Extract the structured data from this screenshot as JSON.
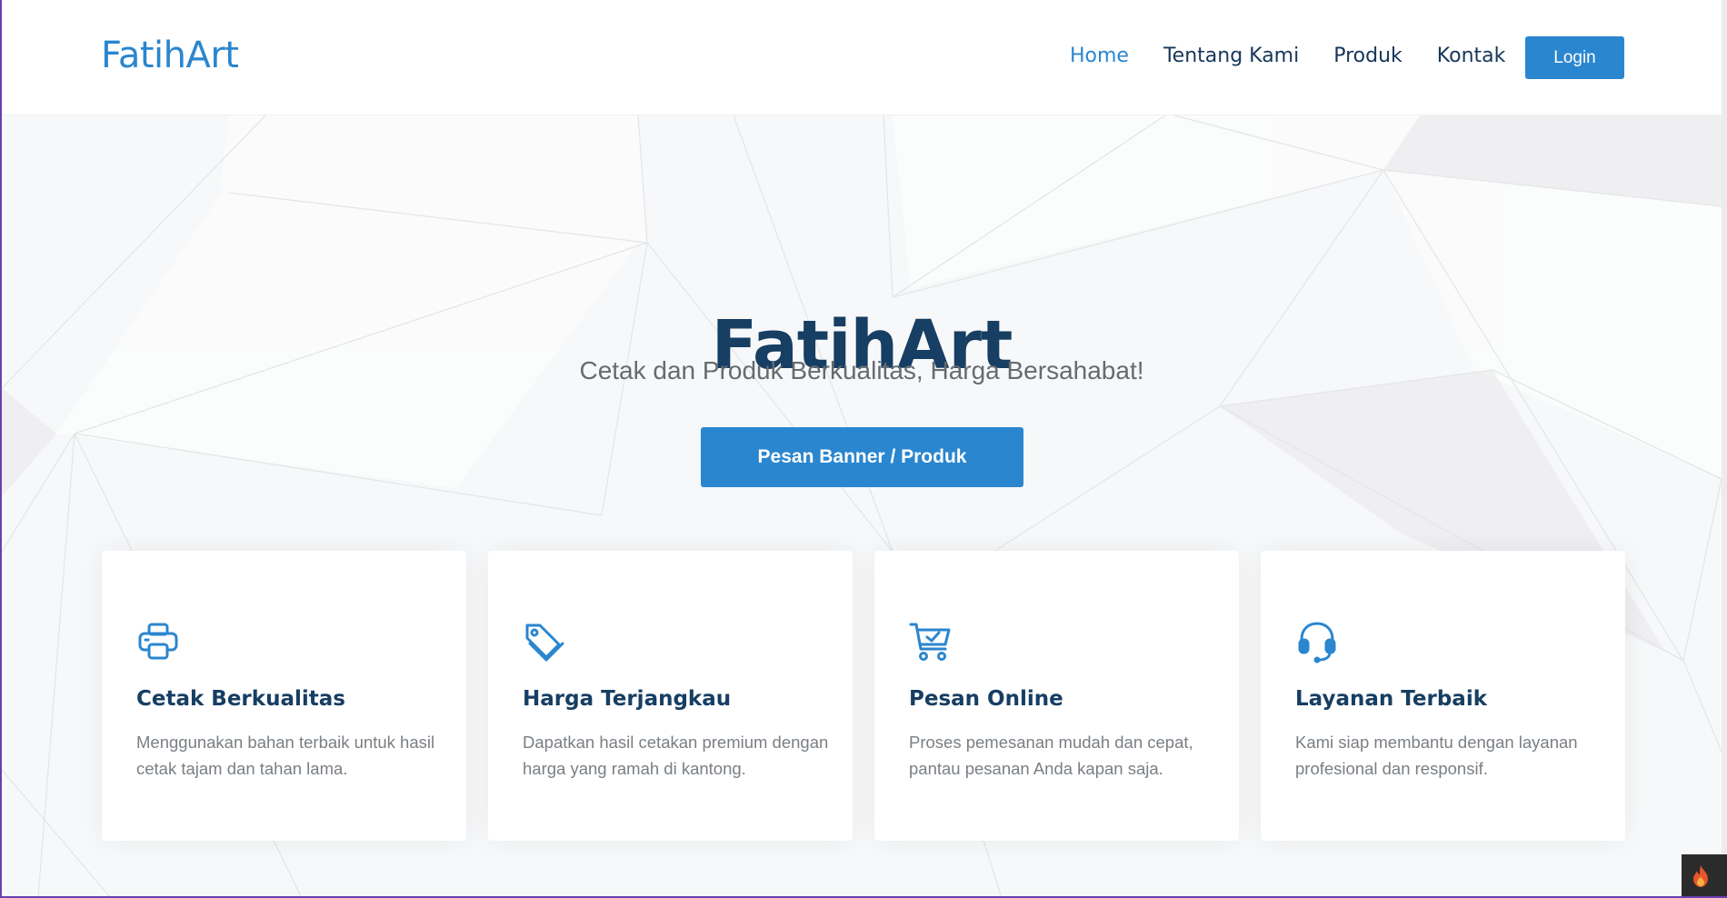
{
  "navbar": {
    "brand": "FatihArt",
    "links": [
      {
        "label": "Home",
        "active": true
      },
      {
        "label": "Tentang Kami",
        "active": false
      },
      {
        "label": "Produk",
        "active": false
      },
      {
        "label": "Kontak",
        "active": false
      }
    ],
    "login_label": "Login"
  },
  "hero": {
    "title": "FatihArt",
    "subtitle": "Cetak dan Produk Berkualitas, Harga Bersahabat!",
    "cta_label": "Pesan Banner / Produk"
  },
  "features": [
    {
      "icon": "printer-icon",
      "title": "Cetak Berkualitas",
      "description": "Menggunakan bahan terbaik untuk hasil cetak tajam dan tahan lama."
    },
    {
      "icon": "price-tag-icon",
      "title": "Harga Terjangkau",
      "description": "Dapatkan hasil cetakan premium dengan harga yang ramah di kantong."
    },
    {
      "icon": "cart-check-icon",
      "title": "Pesan Online",
      "description": "Proses pemesanan mudah dan cepat, pantau pesanan Anda kapan saja."
    },
    {
      "icon": "headset-icon",
      "title": "Layanan Terbaik",
      "description": "Kami siap membantu dengan layanan profesional dan responsif."
    }
  ],
  "colors": {
    "accent": "#2a86cf",
    "heading": "#173e63",
    "muted_text": "#7a7f84",
    "hero_bg": "#f7f8f9"
  }
}
